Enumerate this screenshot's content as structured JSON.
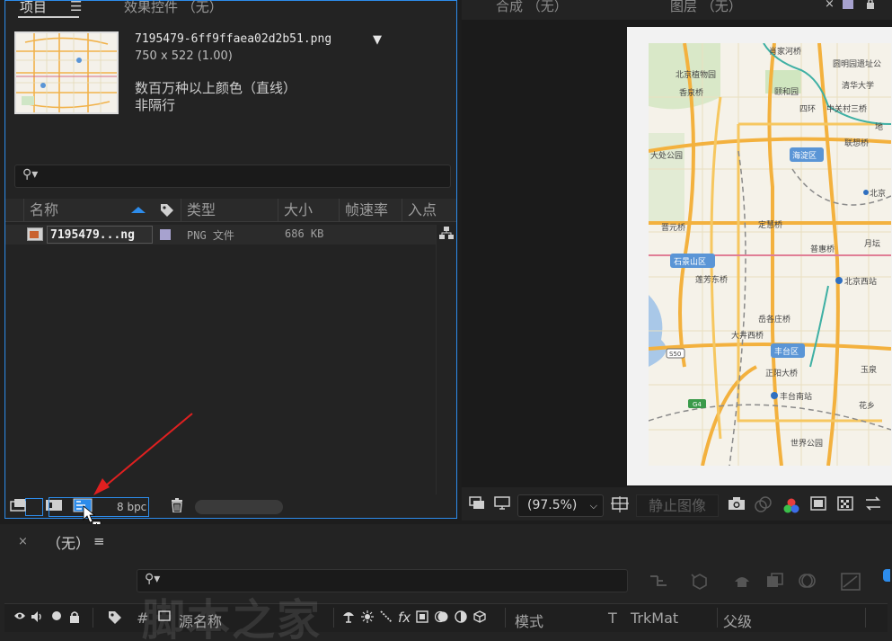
{
  "project_panel": {
    "tab_project": "项目",
    "tab_menu": "☰",
    "tab_effects": "效果控件 （无）",
    "asset": {
      "filename": "7195479-6ff9ffaea02d2b51.png",
      "caret": "▼",
      "dimensions": "750 x 522 (1.00)",
      "color": "数百万种以上颜色（直线）",
      "interlace": "非隔行"
    },
    "search": {
      "icon": "search-icon",
      "glyph": "⚲▾"
    },
    "columns": [
      "名称",
      "类型",
      "大小",
      "帧速率",
      "入点"
    ],
    "rows": [
      {
        "name": "7195479...ng",
        "type": "PNG 文件",
        "size": "686 KB"
      }
    ],
    "footer": {
      "bpc": "8 bpc"
    }
  },
  "comp_panel": {
    "tab_comp": "合成 （无）",
    "tab_layer": "图层 （无）",
    "close": "×",
    "menu": "≡",
    "zoom": "(97.5%)",
    "still_image": "静止图像",
    "map_labels": {
      "l1": "肖家河桥",
      "l2": "圆明园遗址公",
      "l3": "北京植物园",
      "l4": "清华大学",
      "l5": "香泉桥",
      "l6": "颐和园",
      "l7": "四环",
      "l8": "中关村三桥",
      "l9": "地",
      "l10": "大处公园",
      "l11": "联想桥",
      "l12": "海淀区",
      "l13": "北京",
      "l14": "晋元桥",
      "l15": "定慧桥",
      "l16": "普惠桥",
      "l17": "月坛",
      "l18": "石景山区",
      "l19": "莲芳东桥",
      "l20": "北京西站",
      "l21": "岳各庄桥",
      "l22": "大井西桥",
      "l23": "丰台区",
      "l24": "正阳大桥",
      "l25": "玉泉",
      "l26": "丰台南站",
      "l27": "花乡",
      "l28": "世界公园",
      "l29": "S50",
      "l30": "G4"
    }
  },
  "timeline": {
    "close": "×",
    "title": "（无）",
    "menu": "≡",
    "columns": {
      "source_name": "源名称",
      "mode": "模式",
      "t": "T",
      "trkmat": "TrkMat",
      "parent": "父级",
      "hash": "#"
    }
  },
  "colors": {
    "accent_blue": "#2d8ceb",
    "panel_bg": "#232323",
    "arrow_red": "#e02020",
    "label_lavender": "#a7a2cf"
  },
  "watermark": "脚本之家"
}
